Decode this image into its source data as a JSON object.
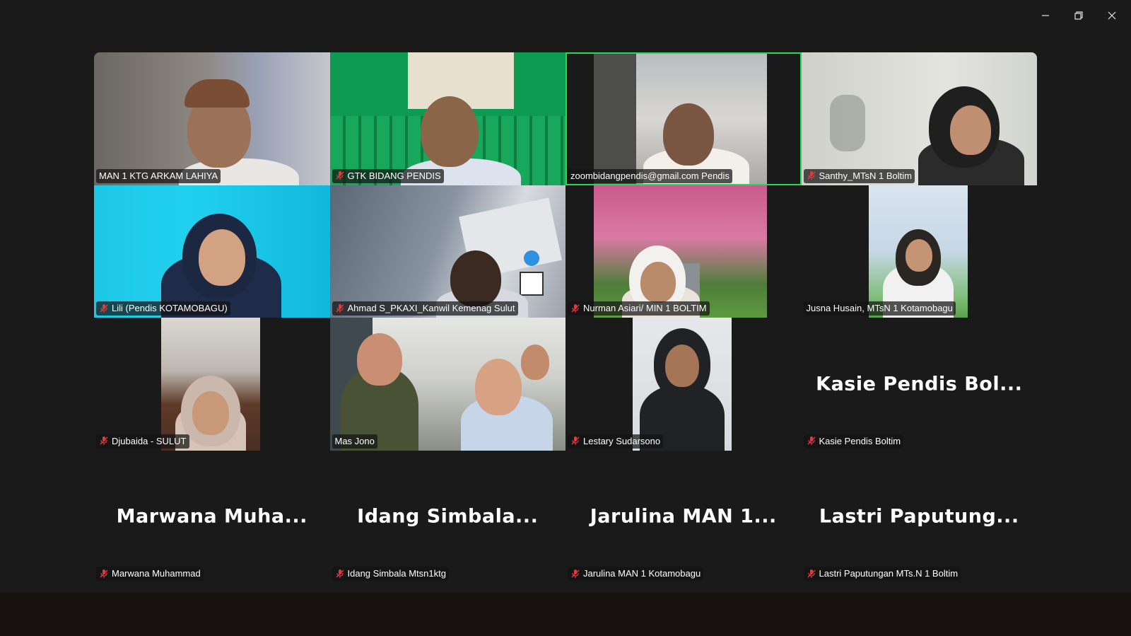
{
  "window": {
    "controls": [
      "minimize-icon",
      "restore-icon",
      "close-icon"
    ]
  },
  "colors": {
    "active_speaker_border": "#23d959",
    "muted_mic": "#e0393e",
    "background": "#1a1a1a"
  },
  "participants": [
    {
      "tag": "MAN 1 KTG ARKAM LAHIYA",
      "muted": false
    },
    {
      "tag": "GTK BIDANG PENDIS",
      "muted": true
    },
    {
      "tag": "zoombidangpendis@gmail.com Pendis",
      "muted": false,
      "active": true
    },
    {
      "tag": "Santhy_MTsN 1 Boltim",
      "muted": true
    },
    {
      "tag": "Lili (Pendis KOTAMOBAGU)",
      "muted": true
    },
    {
      "tag": "Ahmad S_PKAXI_Kanwil Kemenag Sulut",
      "muted": true
    },
    {
      "tag": "Nurman Asiari/ MIN 1 BOLTIM",
      "muted": true
    },
    {
      "tag": "Jusna Husain, MTsN 1 Kotamobagu",
      "muted": false
    },
    {
      "tag": "Djubaida - SULUT",
      "muted": true
    },
    {
      "tag": "Mas Jono",
      "muted": false
    },
    {
      "tag": "Lestary Sudarsono",
      "muted": true
    },
    {
      "tag": "Kasie Pendis Boltim",
      "muted": true,
      "display": "Kasie  Pendis  Bol..."
    },
    {
      "tag": "Marwana Muhammad",
      "muted": true,
      "display": "Marwana  Muha..."
    },
    {
      "tag": "Idang Simbala Mtsn1ktg",
      "muted": true,
      "display": "Idang  Simbala..."
    },
    {
      "tag": "Jarulina MAN 1 Kotamobagu",
      "muted": true,
      "display": "Jarulina  MAN  1..."
    },
    {
      "tag": "Lastri Paputungan MTs.N 1 Boltim",
      "muted": true,
      "display": "Lastri  Paputung..."
    }
  ]
}
